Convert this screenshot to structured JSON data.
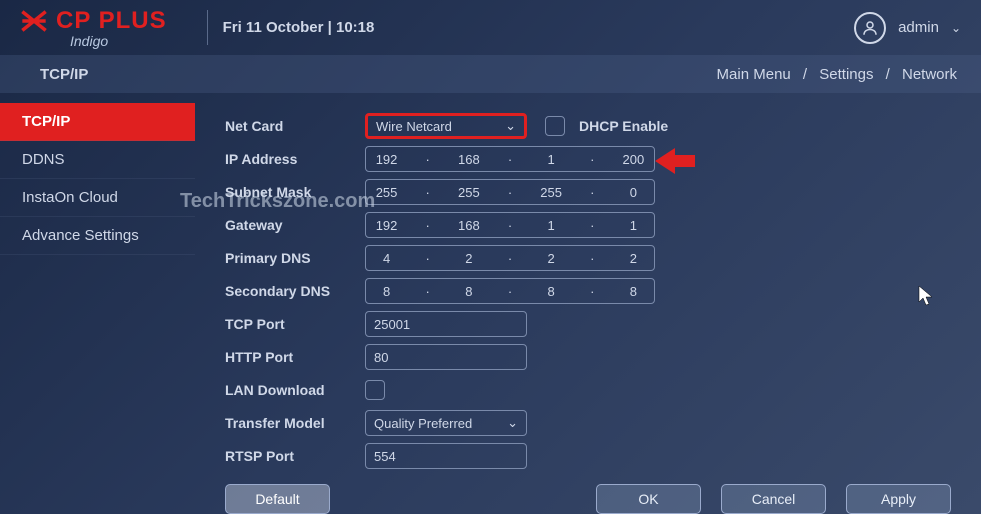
{
  "header": {
    "logo_text": "CP PLUS",
    "logo_sub": "Indigo",
    "datetime": "Fri 11 October | 10:18",
    "user": "admin"
  },
  "subheader": {
    "title": "TCP/IP",
    "breadcrumb": {
      "a": "Main Menu",
      "b": "Settings",
      "c": "Network"
    }
  },
  "sidebar": {
    "items": [
      {
        "label": "TCP/IP",
        "active": true
      },
      {
        "label": "DDNS"
      },
      {
        "label": "InstaOn Cloud"
      },
      {
        "label": "Advance Settings"
      }
    ]
  },
  "form": {
    "netcard_label": "Net Card",
    "netcard_value": "Wire Netcard",
    "dhcp_label": "DHCP Enable",
    "ip_label": "IP Address",
    "ip": {
      "a": "192",
      "b": "168",
      "c": "1",
      "d": "200"
    },
    "subnet_label": "Subnet Mask",
    "subnet": {
      "a": "255",
      "b": "255",
      "c": "255",
      "d": "0"
    },
    "gateway_label": "Gateway",
    "gateway": {
      "a": "192",
      "b": "168",
      "c": "1",
      "d": "1"
    },
    "pdns_label": "Primary DNS",
    "pdns": {
      "a": "4",
      "b": "2",
      "c": "2",
      "d": "2"
    },
    "sdns_label": "Secondary DNS",
    "sdns": {
      "a": "8",
      "b": "8",
      "c": "8",
      "d": "8"
    },
    "tcpport_label": "TCP Port",
    "tcpport": "25001",
    "httpport_label": "HTTP Port",
    "httpport": "80",
    "lan_label": "LAN Download",
    "transfer_label": "Transfer Model",
    "transfer_value": "Quality Preferred",
    "rtsp_label": "RTSP Port",
    "rtsp": "554"
  },
  "buttons": {
    "default": "Default",
    "ok": "OK",
    "cancel": "Cancel",
    "apply": "Apply"
  },
  "watermark": "TechTrickszone.com"
}
